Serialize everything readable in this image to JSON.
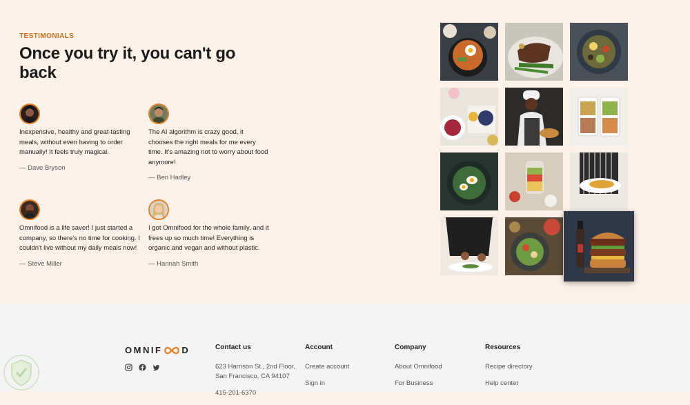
{
  "testimonials": {
    "subheading": "TESTIMONIALS",
    "heading": "Once you try it, you can't go back",
    "items": [
      {
        "text": "Inexpensive, healthy and great-tasting meals, without even having to order manually! It feels truly magical.",
        "name": "— Dave Bryson"
      },
      {
        "text": "The AI algorithm is crazy good, it chooses the right meals for me every time. It's amazing not to worry about food anymore!",
        "name": "— Ben Hadley"
      },
      {
        "text": "Omnifood is a life saver! I just started a company, so there's no time for cooking. I couldn't live without my daily meals now!",
        "name": "— Steve Miller"
      },
      {
        "text": "I got Omnifood for the whole family, and it frees up so much time! Everything is organic and vegan and without plastic.",
        "name": "— Hannah Smith"
      }
    ]
  },
  "gallery": {
    "icons": [
      "food-photo-icon"
    ],
    "colors": {
      "accent": "#e67e22",
      "subheading": "#cf711f",
      "section_bg": "#fdf2e9",
      "footer_bg": "#f4f4f4"
    }
  },
  "footer": {
    "logo": {
      "part1": "OMNIF",
      "part2": "D"
    },
    "socials": [
      "instagram-icon",
      "facebook-icon",
      "twitter-icon"
    ],
    "contact": {
      "title": "Contact us",
      "address_line1": "623 Harrison St., 2nd Floor,",
      "address_line2": "San Francisco, CA 94107",
      "phone": "415-201-6370"
    },
    "account": {
      "title": "Account",
      "items": [
        "Create account",
        "Sign in"
      ]
    },
    "company": {
      "title": "Company",
      "items": [
        "About Omnifood",
        "For Business"
      ]
    },
    "resources": {
      "title": "Resources",
      "items": [
        "Recipe directory",
        "Help center"
      ]
    }
  }
}
